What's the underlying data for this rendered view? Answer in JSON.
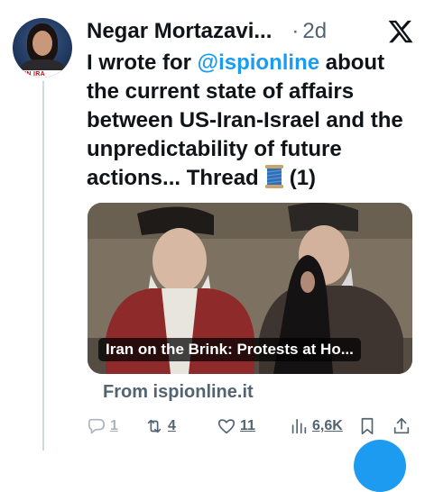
{
  "tweet": {
    "author_name": "Negar Mortazavi...",
    "time_dot": "·",
    "time": "2d",
    "avatar_banner": "E IN IRA",
    "text_before": "I wrote for ",
    "mention": "@ispionline",
    "text_after": " about the current state of affairs between US-Iran-Israel and the unpredictability of future actions... Thread",
    "text_end": "(1)",
    "emoji": "spool-of-thread",
    "platform_icon": "x-logo"
  },
  "link_card": {
    "caption": "Iran on the Brink: Protests at Ho...",
    "source": "From ispionline.it"
  },
  "actions": {
    "replies": "1",
    "retweets": "4",
    "likes": "11",
    "views": "6,6K"
  },
  "colors": {
    "accent": "#1d9bf0",
    "text": "#0f1419",
    "secondary": "#536471",
    "thread_line": "#cfd9de"
  }
}
